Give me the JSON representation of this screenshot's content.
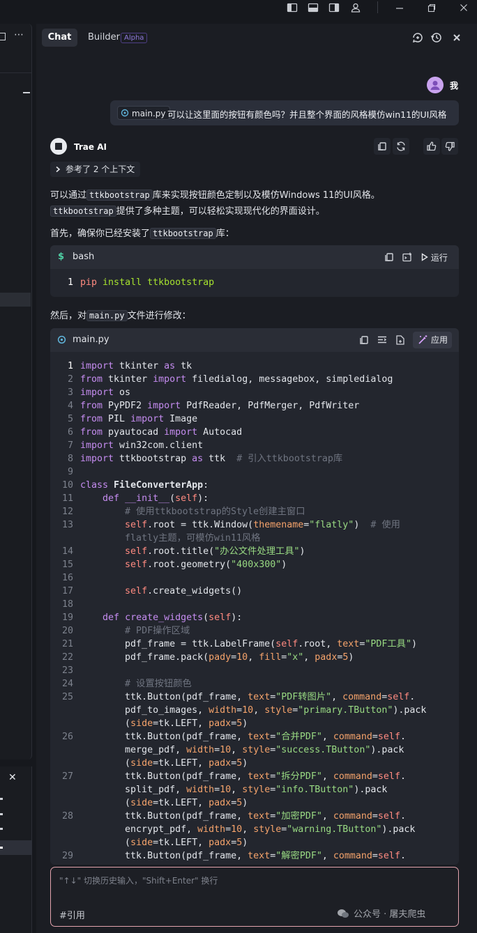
{
  "titlebar": {
    "icons": [
      "toggle-left-sidebar-icon",
      "toggle-panel-icon",
      "toggle-right-sidebar-icon",
      "account-icon",
      "minimize-icon",
      "restore-icon",
      "close-icon"
    ]
  },
  "chat": {
    "tabs": {
      "chat": "Chat",
      "builder": "Builder",
      "builder_badge": "Alpha"
    },
    "user": {
      "name": "我",
      "file_chip": "main.py",
      "message": "可以让这里面的按钮有颜色吗？并且整个界面的风格模仿win11的UI风格"
    },
    "ai": {
      "name": "Trae AI",
      "ref": "参考了 2 个上下文",
      "p1_a": "可以通过",
      "p1_code": "ttkbootstrap",
      "p1_b": "库来实现按钮颜色定制以及模仿Windows 11的UI风格。",
      "p2_code": "ttkbootstrap",
      "p2_b": "提供了多种主题，可以轻松实现现代化的界面设计。",
      "p3_a": "首先，确保你已经安装了",
      "p3_code": "ttkbootstrap",
      "p3_b": "库：",
      "p4_a": "然后，对",
      "p4_code": "main.py",
      "p4_b": "文件进行修改："
    },
    "bash_block": {
      "lang": "bash",
      "run_label": "运行",
      "line_no": "1",
      "line": "pip install ttkbootstrap"
    },
    "main_block": {
      "lang": "main.py",
      "apply_label": "应用"
    },
    "input": {
      "placeholder": "\"↑↓\" 切换历史输入，\"Shift+Enter\" 换行",
      "cite_label": "#引用",
      "watermark": "公众号 · 屠夫爬虫"
    }
  }
}
